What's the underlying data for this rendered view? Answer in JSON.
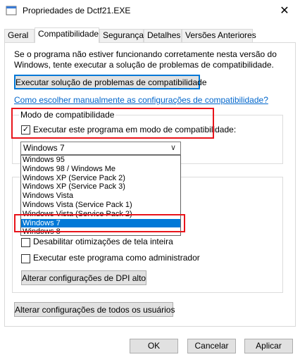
{
  "window": {
    "title": "Propriedades de Dctf21.EXE",
    "close_glyph": "✕"
  },
  "tabs": [
    {
      "label": "Geral",
      "active": false
    },
    {
      "label": "Compatibilidade",
      "active": true
    },
    {
      "label": "Segurança",
      "active": false
    },
    {
      "label": "Detalhes",
      "active": false
    },
    {
      "label": "Versões Anteriores",
      "active": false
    }
  ],
  "compat": {
    "intro": "Se o programa não estiver funcionando corretamente nesta versão do Windows, tente executar a solução de problemas de compatibilidade.",
    "troubleshooter_button": "Executar solução de problemas de compatibilidade",
    "manual_link": "Como escolher manualmente as configurações de compatibilidade?",
    "mode_group_label": "Modo de compatibilidade",
    "mode_checkbox_label": "Executar este programa em modo de compatibilidade:",
    "mode_checked": true,
    "selected_os": "Windows 7",
    "os_options": [
      "Windows 95",
      "Windows 98 / Windows Me",
      "Windows XP (Service Pack 2)",
      "Windows XP (Service Pack 3)",
      "Windows Vista",
      "Windows Vista (Service Pack 1)",
      "Windows Vista (Service Pack 2)",
      "Windows 7",
      "Windows 8"
    ],
    "fullscreen_opt_label": "Desabilitar otimizações de tela inteira",
    "admin_label": "Executar este programa como administrador",
    "dpi_button": "Alterar configurações de DPI alto",
    "all_users_button": "Alterar configurações de todos os usuários"
  },
  "footer": {
    "ok": "OK",
    "cancel": "Cancelar",
    "apply": "Aplicar"
  },
  "colors": {
    "accent": "#0078d7",
    "highlight_box": "#e8141b",
    "link": "#0066cc"
  },
  "icons": {
    "app": "app-icon",
    "check": "checkmark-icon",
    "dropdown": "chevron-down-icon"
  }
}
